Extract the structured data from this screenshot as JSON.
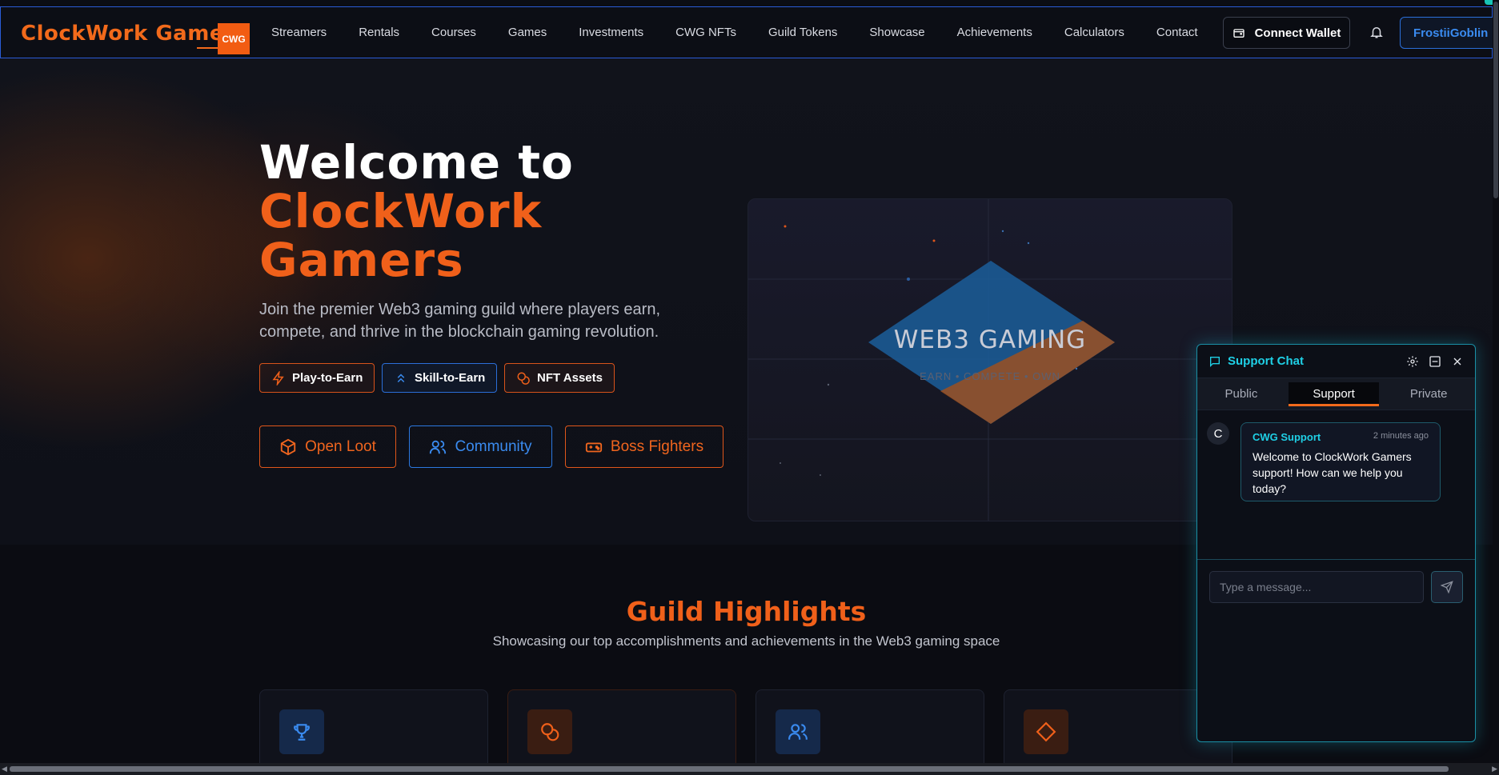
{
  "nav": {
    "brand": "ClockWork Gamers",
    "badge": "CWG",
    "links": [
      "Streamers",
      "Rentals",
      "Courses",
      "Games",
      "Investments",
      "CWG NFTs",
      "Guild Tokens",
      "Showcase",
      "Achievements",
      "Calculators",
      "Contact"
    ],
    "wallet_label": "Connect Wallet",
    "user_label": "FrostiiGoblin"
  },
  "hero": {
    "title_line1": "Welcome to",
    "title_line2": "ClockWork",
    "title_line3": "Gamers",
    "subtitle": "Join the premier Web3 gaming guild where players earn, compete, and thrive in the blockchain gaming revolution.",
    "tags": [
      "Play-to-Earn",
      "Skill-to-Earn",
      "NFT Assets"
    ],
    "ctas": [
      "Open Loot",
      "Community",
      "Boss Fighters"
    ],
    "card_title": "WEB3 GAMING",
    "card_subtitle": "EARN • COMPETE • OWN"
  },
  "highlights": {
    "title": "Guild Highlights",
    "subtitle": "Showcasing our top accomplishments and achievements in the Web3 gaming space"
  },
  "chat": {
    "title": "Support Chat",
    "tabs": [
      "Public",
      "Support",
      "Private"
    ],
    "active_tab": "Support",
    "avatar_initial": "C",
    "message": {
      "sender": "CWG Support",
      "time": "2 minutes ago",
      "text": "Welcome to ClockWork Gamers support! How can we help you today?"
    },
    "input_placeholder": "Type a message..."
  },
  "colors": {
    "accent_orange": "#f0601a",
    "accent_blue": "#2b78e0",
    "accent_cyan": "#1fd0e6",
    "background": "#0b0d14"
  }
}
